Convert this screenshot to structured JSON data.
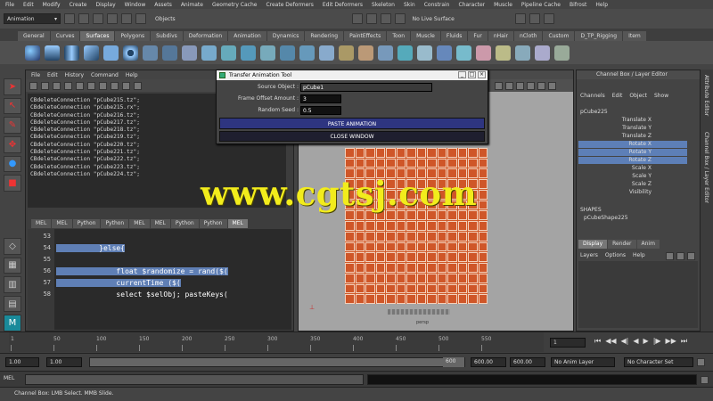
{
  "menubar": [
    "File",
    "Edit",
    "Modify",
    "Create",
    "Display",
    "Window",
    "Assets",
    "Animate",
    "Geometry Cache",
    "Create Deformers",
    "Edit Deformers",
    "Skeleton",
    "Skin",
    "Constrain",
    "Character",
    "Muscle",
    "Pipeline Cache",
    "Bifrost",
    "Help"
  ],
  "status": {
    "mode": "Animation",
    "select_label": "Objects",
    "live_surface": "No Live Surface"
  },
  "shelf_tabs": [
    "General",
    "Curves",
    "Surfaces",
    "Polygons",
    "Subdivs",
    "Deformation",
    "Animation",
    "Dynamics",
    "Rendering",
    "PaintEffects",
    "Toon",
    "Muscle",
    "Fluids",
    "Fur",
    "nHair",
    "nCloth",
    "Custom",
    "D_TP_Rigging",
    "Item"
  ],
  "shelf_active": "Surfaces",
  "script_editor": {
    "menu": [
      "File",
      "Edit",
      "History",
      "Command",
      "Help"
    ],
    "history": [
      "CBdeleteConnection \"pCube215.tz\";",
      "CBdeleteConnection \"pCube215.rx\";",
      "CBdeleteConnection \"pCube216.tz\";",
      "CBdeleteConnection \"pCube217.tz\";",
      "CBdeleteConnection \"pCube218.tz\";",
      "CBdeleteConnection \"pCube219.tz\";",
      "CBdeleteConnection \"pCube220.tz\";",
      "CBdeleteConnection \"pCube221.tz\";",
      "CBdeleteConnection \"pCube222.tz\";",
      "CBdeleteConnection \"pCube223.tz\";",
      "CBdeleteConnection \"pCube224.tz\";"
    ],
    "tabs": [
      "MEL",
      "MEL",
      "Python",
      "Python",
      "MEL",
      "MEL",
      "Python",
      "Python",
      "MEL"
    ],
    "active_tab_index": 8,
    "line_numbers": [
      "53",
      "54",
      "55",
      "56",
      "57",
      "58"
    ],
    "code": [
      {
        "text": "",
        "sel": true
      },
      {
        "text": "          }else{",
        "sel": true
      },
      {
        "text": "",
        "sel": false
      },
      {
        "text": "              float $randomize = rand($(",
        "sel": true
      },
      {
        "text": "              currentTime ($(",
        "sel": true
      },
      {
        "text": "              select $selObj; pasteKeys(",
        "sel": false
      }
    ]
  },
  "viewport": {
    "menu": [
      "View",
      "Shading",
      "Lighting",
      "Show",
      "Renderer",
      "Panels"
    ],
    "camera": "persp"
  },
  "dialog": {
    "title": "Transfer Animation Tool",
    "source_label": "Source Object :",
    "source_value": "pCube1",
    "offset_label": "Frame Offset Amount :",
    "offset_value": "3",
    "random_label": "Random Seed :",
    "random_value": "0.5",
    "paste_button": "PASTE ANIMATION",
    "close_button": "CLOSE WINDOW"
  },
  "watermark": "www.cgtsj.com",
  "channel_box": {
    "title": "Channel Box / Layer Editor",
    "menu": [
      "Channels",
      "Edit",
      "Object",
      "Show"
    ],
    "object": "pCube225",
    "attributes": [
      {
        "name": "Translate X",
        "value": "",
        "hl": false
      },
      {
        "name": "Translate Y",
        "value": "",
        "hl": false
      },
      {
        "name": "Translate Z",
        "value": "",
        "hl": false
      },
      {
        "name": "Rotate X",
        "value": "",
        "hl": true
      },
      {
        "name": "Rotate Y",
        "value": "",
        "hl": true
      },
      {
        "name": "Rotate Z",
        "value": "",
        "hl": true
      },
      {
        "name": "Scale X",
        "value": "",
        "hl": false
      },
      {
        "name": "Scale Y",
        "value": "",
        "hl": false
      },
      {
        "name": "Scale Z",
        "value": "",
        "hl": false
      },
      {
        "name": "Visibility",
        "value": "",
        "hl": false
      }
    ],
    "shapes_label": "SHAPES",
    "shape": "pCubeShape225",
    "layer_tabs": [
      "Display",
      "Render",
      "Anim"
    ],
    "layer_menu": [
      "Layers",
      "Options",
      "Help"
    ],
    "side_tabs": [
      "Attribute Editor",
      "Channel Box / Layer Editor"
    ]
  },
  "timeline": {
    "ticks": [
      "1",
      "50",
      "100",
      "150",
      "200",
      "250",
      "300",
      "350",
      "400",
      "450",
      "500",
      "550"
    ],
    "current_frame": "1",
    "playback_glyphs": [
      "⏮",
      "◀◀",
      "◀|",
      "◀",
      "▶",
      "|▶",
      "▶▶",
      "⏭"
    ]
  },
  "range": {
    "start": "1.00",
    "start2": "1.00",
    "range_end": "600",
    "end": "600.00",
    "end2": "600.00",
    "anim_layer": "No Anim Layer",
    "char_set": "No Character Set"
  },
  "cmd": {
    "label": "MEL"
  },
  "help": "Channel Box: LMB Select. MMB Slide."
}
